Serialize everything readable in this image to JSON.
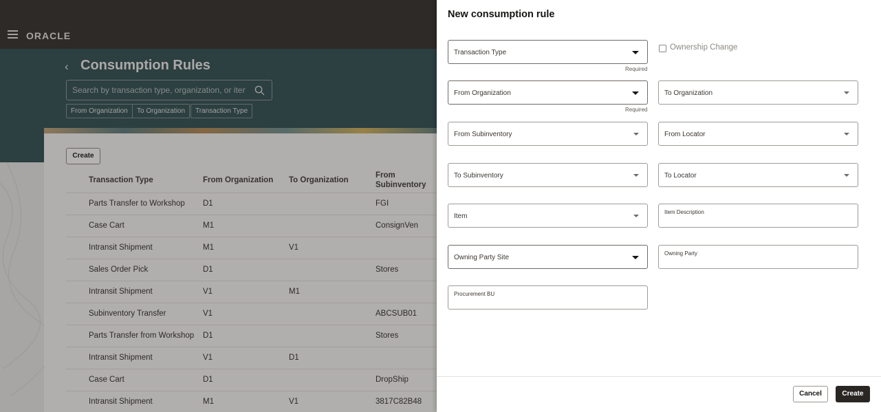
{
  "app": {
    "logo": "ORACLE"
  },
  "page": {
    "title": "Consumption Rules",
    "search_placeholder": "Search by transaction type, organization, or item",
    "filter_chips": [
      "From Organization",
      "To Organization",
      "Transaction Type"
    ],
    "create_label": "Create"
  },
  "table": {
    "headers": [
      "Transaction Type",
      "From Organization",
      "To Organization",
      "From Subinventory"
    ],
    "rows": [
      [
        "Parts Transfer to Workshop",
        "D1",
        "",
        "FGI"
      ],
      [
        "Case Cart",
        "M1",
        "",
        "ConsignVen"
      ],
      [
        "Intransit Shipment",
        "M1",
        "V1",
        ""
      ],
      [
        "Sales Order Pick",
        "D1",
        "",
        "Stores"
      ],
      [
        "Intransit Shipment",
        "V1",
        "M1",
        ""
      ],
      [
        "Subinventory Transfer",
        "V1",
        "",
        "ABCSUB01"
      ],
      [
        "Parts Transfer from Workshop",
        "D1",
        "",
        "Stores"
      ],
      [
        "Intransit Shipment",
        "V1",
        "D1",
        ""
      ],
      [
        "Case Cart",
        "D1",
        "",
        "DropShip"
      ],
      [
        "Intransit Shipment",
        "M1",
        "V1",
        "3817C82B48"
      ]
    ]
  },
  "drawer": {
    "title": "New consumption rule",
    "fields": {
      "transaction_type": "Transaction Type",
      "ownership_change": "Ownership Change",
      "from_organization": "From Organization",
      "to_organization": "To Organization",
      "from_subinventory": "From Subinventory",
      "from_locator": "From Locator",
      "to_subinventory": "To Subinventory",
      "to_locator": "To Locator",
      "item": "Item",
      "item_description": "Item Description",
      "owning_party_site": "Owning Party Site",
      "owning_party": "Owning Party",
      "procurement_bu": "Procurement BU"
    },
    "required_label": "Required",
    "cancel_label": "Cancel",
    "create_label": "Create"
  },
  "colors": {
    "header": "#312d2a",
    "hero": "#2f4e52",
    "primary_button": "#2a2623"
  }
}
